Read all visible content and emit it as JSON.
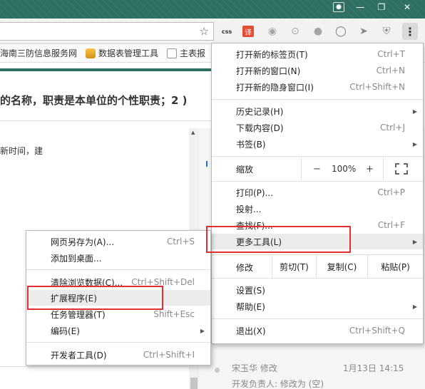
{
  "bookmarks": [
    {
      "label": "海南三防信息服务网"
    },
    {
      "label": "数据表管理工具"
    },
    {
      "label": "主表报"
    }
  ],
  "extensions": {
    "css_label": "css",
    "translate_label": "译"
  },
  "page": {
    "heading": "的名称，职责是本单位的个性职责；2 )",
    "body_text": "新时间，建",
    "log_entries": [
      {
        "user_action": "宋玉华  修改",
        "date": "1月13日 14:15"
      },
      {
        "detail": "开发负责人: 修改为 (空)"
      }
    ]
  },
  "main_menu": {
    "items": [
      {
        "label": "打开新的标签页(T)",
        "shortcut": "Ctrl+T"
      },
      {
        "label": "打开新的窗口(N)",
        "shortcut": "Ctrl+N"
      },
      {
        "label": "打开新的隐身窗口(I)",
        "shortcut": "Ctrl+Shift+N"
      },
      {
        "label": "历史记录(H)",
        "shortcut": ""
      },
      {
        "label": "下载内容(D)",
        "shortcut": "Ctrl+J"
      },
      {
        "label": "书签(B)",
        "shortcut": ""
      },
      {
        "label": "打印(P)...",
        "shortcut": "Ctrl+P"
      },
      {
        "label": "投射...",
        "shortcut": ""
      },
      {
        "label": "查找(F)...",
        "shortcut": "Ctrl+F"
      },
      {
        "label": "更多工具(L)",
        "shortcut": ""
      },
      {
        "label": "设置(S)",
        "shortcut": ""
      },
      {
        "label": "帮助(E)",
        "shortcut": ""
      },
      {
        "label": "退出(X)",
        "shortcut": "Ctrl+Shift+Q"
      }
    ],
    "zoom": {
      "label": "缩放",
      "minus": "−",
      "value": "100%",
      "plus": "+"
    },
    "edit": {
      "label": "修改",
      "cut": "剪切(T)",
      "copy": "复制(C)",
      "paste": "粘贴(P)"
    }
  },
  "sub_menu": {
    "items": [
      {
        "label": "网页另存为(A)...",
        "shortcut": "Ctrl+S"
      },
      {
        "label": "添加到桌面...",
        "shortcut": ""
      },
      {
        "label": "清除浏览数据(C)...",
        "shortcut": "Ctrl+Shift+Del"
      },
      {
        "label": "扩展程序(E)",
        "shortcut": ""
      },
      {
        "label": "任务管理器(T)",
        "shortcut": "Shift+Esc"
      },
      {
        "label": "编码(E)",
        "shortcut": ""
      },
      {
        "label": "开发者工具(D)",
        "shortcut": "Ctrl+Shift+I"
      }
    ]
  },
  "colors": {
    "titlebar": "#2f6f63",
    "highlight_box": "#e03131",
    "menu_hover": "#ececec"
  }
}
